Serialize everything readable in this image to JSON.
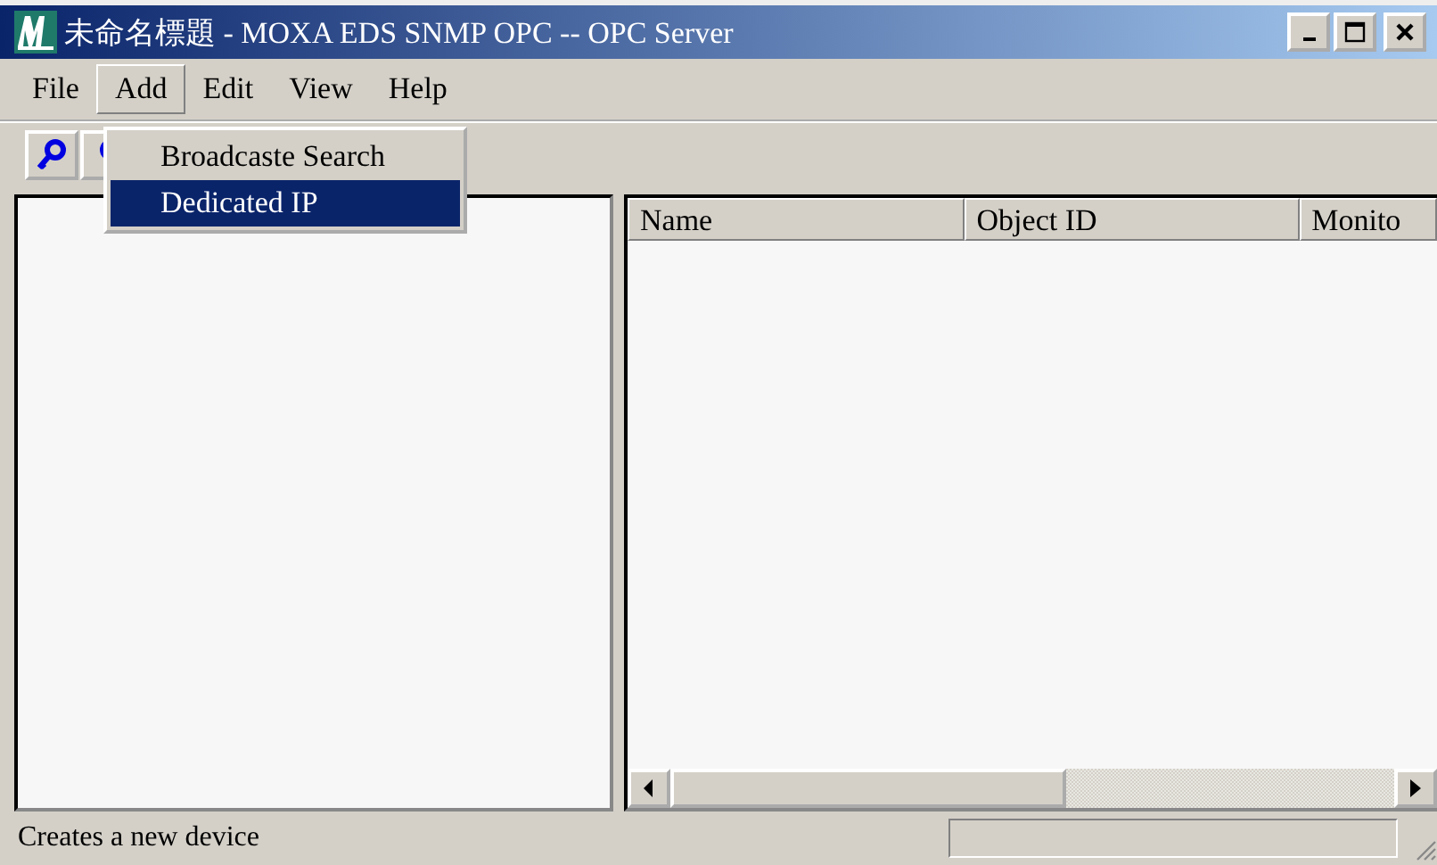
{
  "window": {
    "title": "未命名標題 - MOXA EDS SNMP OPC -- OPC Server"
  },
  "menu": [
    {
      "label": "File",
      "selected": false
    },
    {
      "label": "Add",
      "selected": true
    },
    {
      "label": "Edit",
      "selected": false
    },
    {
      "label": "View",
      "selected": false
    },
    {
      "label": "Help",
      "selected": false
    }
  ],
  "dropdown": [
    {
      "label": "Broadcaste Search",
      "selected": false
    },
    {
      "label": "Dedicated IP",
      "selected": true
    }
  ],
  "table": {
    "columns": [
      "Name",
      "Object ID",
      "Monito"
    ]
  },
  "status_bar": {
    "message": "Creates a new device"
  }
}
